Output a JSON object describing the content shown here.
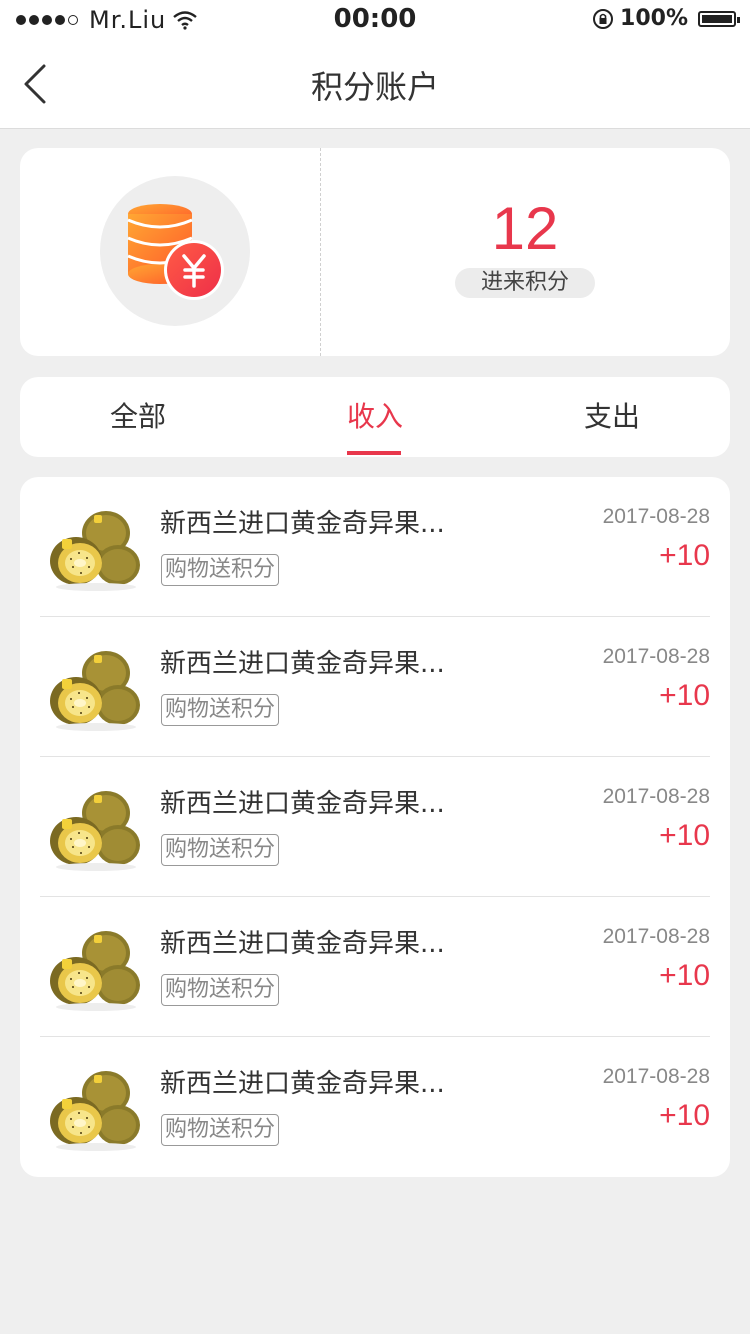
{
  "status_bar": {
    "carrier": "Mr.Liu",
    "time": "00:00",
    "battery": "100%"
  },
  "nav": {
    "title": "积分账户"
  },
  "summary": {
    "points": "12",
    "points_label": "进来积分"
  },
  "tabs": [
    {
      "label": "全部",
      "active": false
    },
    {
      "label": "收入",
      "active": true
    },
    {
      "label": "支出",
      "active": false
    }
  ],
  "records": [
    {
      "title": "新西兰进口黄金奇异果...",
      "tag": "购物送积分",
      "date": "2017-08-28",
      "points": "+10"
    },
    {
      "title": "新西兰进口黄金奇异果...",
      "tag": "购物送积分",
      "date": "2017-08-28",
      "points": "+10"
    },
    {
      "title": "新西兰进口黄金奇异果...",
      "tag": "购物送积分",
      "date": "2017-08-28",
      "points": "+10"
    },
    {
      "title": "新西兰进口黄金奇异果...",
      "tag": "购物送积分",
      "date": "2017-08-28",
      "points": "+10"
    },
    {
      "title": "新西兰进口黄金奇异果...",
      "tag": "购物送积分",
      "date": "2017-08-28",
      "points": "+10"
    }
  ],
  "colors": {
    "accent": "#e8374c",
    "background": "#efefef"
  }
}
